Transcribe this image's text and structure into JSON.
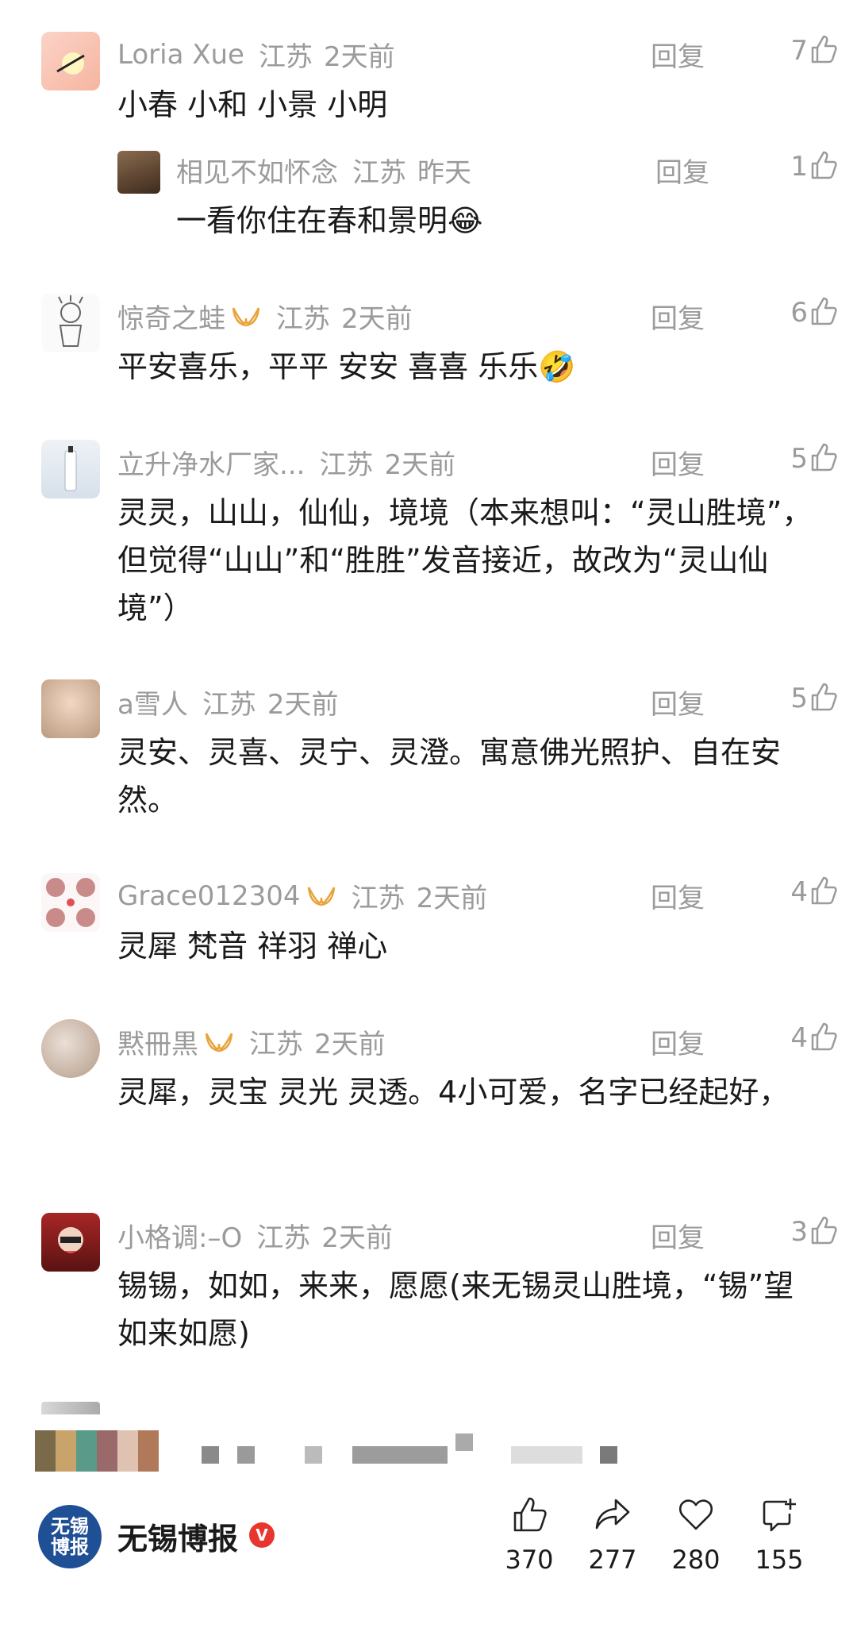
{
  "comments": [
    {
      "name": "Loria  Xue",
      "location": "江苏",
      "time": "2天前",
      "reply": "回复",
      "likes": "7",
      "text": "小春 小和 小景 小明",
      "avatar_color": "#f4c6b9"
    },
    {
      "name": "相见不如怀念",
      "location": "江苏",
      "time": "昨天",
      "reply": "回复",
      "likes": "1",
      "text": "一看你住在春和景明😂",
      "avatar_color": "#5a3e2b"
    },
    {
      "name": "惊奇之蛙",
      "location": "江苏",
      "time": "2天前",
      "reply": "回复",
      "likes": "6",
      "text": "平安喜乐，平平 安安 喜喜 乐乐🤣",
      "avatar_color": "#f5f5f5"
    },
    {
      "name": "立升净水厂家...",
      "location": "江苏",
      "time": "2天前",
      "reply": "回复",
      "likes": "5",
      "text": "灵灵，山山，仙仙，境境（本来想叫：“灵山胜境”，但觉得“山山”和“胜胜”发音接近，故改为“灵山仙境”）",
      "avatar_color": "#e6ecf2"
    },
    {
      "name": "a雪人",
      "location": "江苏",
      "time": "2天前",
      "reply": "回复",
      "likes": "5",
      "text": "灵安、灵喜、灵宁、灵澄。寓意佛光照护、自在安然。",
      "avatar_color": "#d9c2a8"
    },
    {
      "name": "Grace012304",
      "location": "江苏",
      "time": "2天前",
      "reply": "回复",
      "likes": "4",
      "text": "灵犀 梵音 祥羽 禅心",
      "avatar_color": "#f0e0e0"
    },
    {
      "name": "黙冊黒",
      "location": "江苏",
      "time": "2天前",
      "reply": "回复",
      "likes": "4",
      "text": "灵犀，灵宝  灵光  灵透。4小可爱，名字已经起好，",
      "avatar_color": "#c9b8a8"
    },
    {
      "name": "小格调:–O",
      "location": "江苏",
      "time": "2天前",
      "reply": "回复",
      "likes": "3",
      "text": "锡锡，如如，来来，愿愿(来无锡灵山胜境，“锡”望如来如愿)",
      "avatar_color": "#7a1d1d"
    }
  ],
  "footer": {
    "brand_name": "无锡博报",
    "logo_text": "无锡\n博报",
    "verified_mark": "V",
    "actions": [
      {
        "icon": "thumbs-up-icon",
        "count": "370"
      },
      {
        "icon": "share-icon",
        "count": "277"
      },
      {
        "icon": "heart-icon",
        "count": "280"
      },
      {
        "icon": "comment-add-icon",
        "count": "155"
      }
    ]
  },
  "colors": {
    "meta_gray": "#9b9b9b",
    "text": "#1a1a1a",
    "brand_blue": "#1f4f95",
    "verified_red": "#e8352e",
    "badge_gold": "#e8a43a"
  }
}
